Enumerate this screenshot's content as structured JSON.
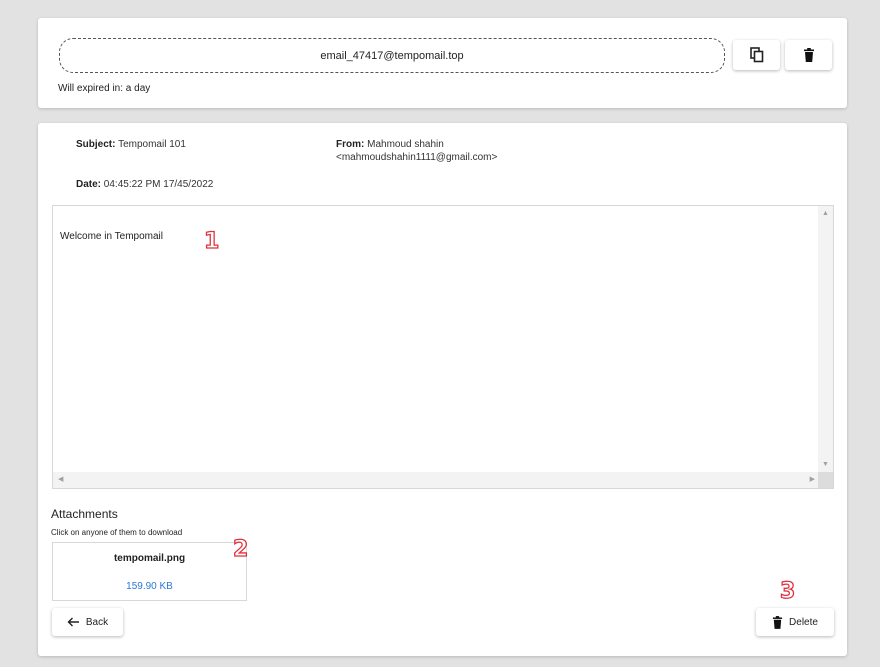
{
  "top": {
    "email": "email_47417@tempomail.top",
    "expire_text": "Will expired in: a day",
    "copy_icon": "copy-icon",
    "trash_icon": "trash-icon"
  },
  "mail": {
    "subject_label": "Subject:",
    "subject": "Tempomail 101",
    "from_label": "From:",
    "from_name": "Mahmoud shahin",
    "from_email": "<mahmoudshahin1111@gmail.com>",
    "date_label": "Date:",
    "date": "04:45:22 PM 17/45/2022",
    "body": "Welcome in Tempomail"
  },
  "attachments": {
    "title": "Attachments",
    "hint": "Click on anyone of them to download",
    "items": [
      {
        "name": "tempomail.png",
        "size": "159.90 KB"
      }
    ]
  },
  "actions": {
    "back_label": "Back",
    "delete_label": "Delete"
  },
  "markers": [
    "1",
    "2",
    "3"
  ],
  "footer": "",
  "colors": {
    "link": "#2a78d6",
    "marker": "#e0313d",
    "background": "#e2e2e2"
  }
}
